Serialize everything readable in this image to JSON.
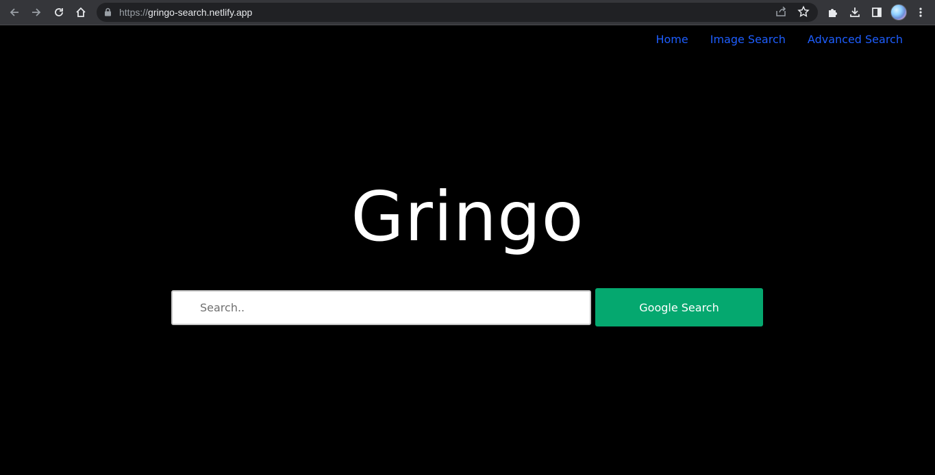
{
  "browser": {
    "url_scheme": "https://",
    "url_host": "gringo-search.netlify.app",
    "icons": {
      "back": "arrow-left-icon",
      "forward": "arrow-right-icon",
      "reload": "reload-icon",
      "home": "home-icon",
      "lock": "lock-icon",
      "share": "share-icon",
      "bookmark": "star-icon",
      "extensions": "puzzle-icon",
      "downloads": "download-icon",
      "side_panel": "side-panel-icon",
      "menu": "kebab-menu-icon"
    }
  },
  "nav": {
    "items": [
      {
        "label": "Home"
      },
      {
        "label": "Image Search"
      },
      {
        "label": "Advanced Search"
      }
    ]
  },
  "hero": {
    "title": "Gringo"
  },
  "search": {
    "placeholder": "Search..",
    "value": "",
    "button_label": "Google Search"
  },
  "colors": {
    "background": "#000000",
    "nav_link": "#1e5eff",
    "button": "#05a86f",
    "title": "#ffffff"
  }
}
